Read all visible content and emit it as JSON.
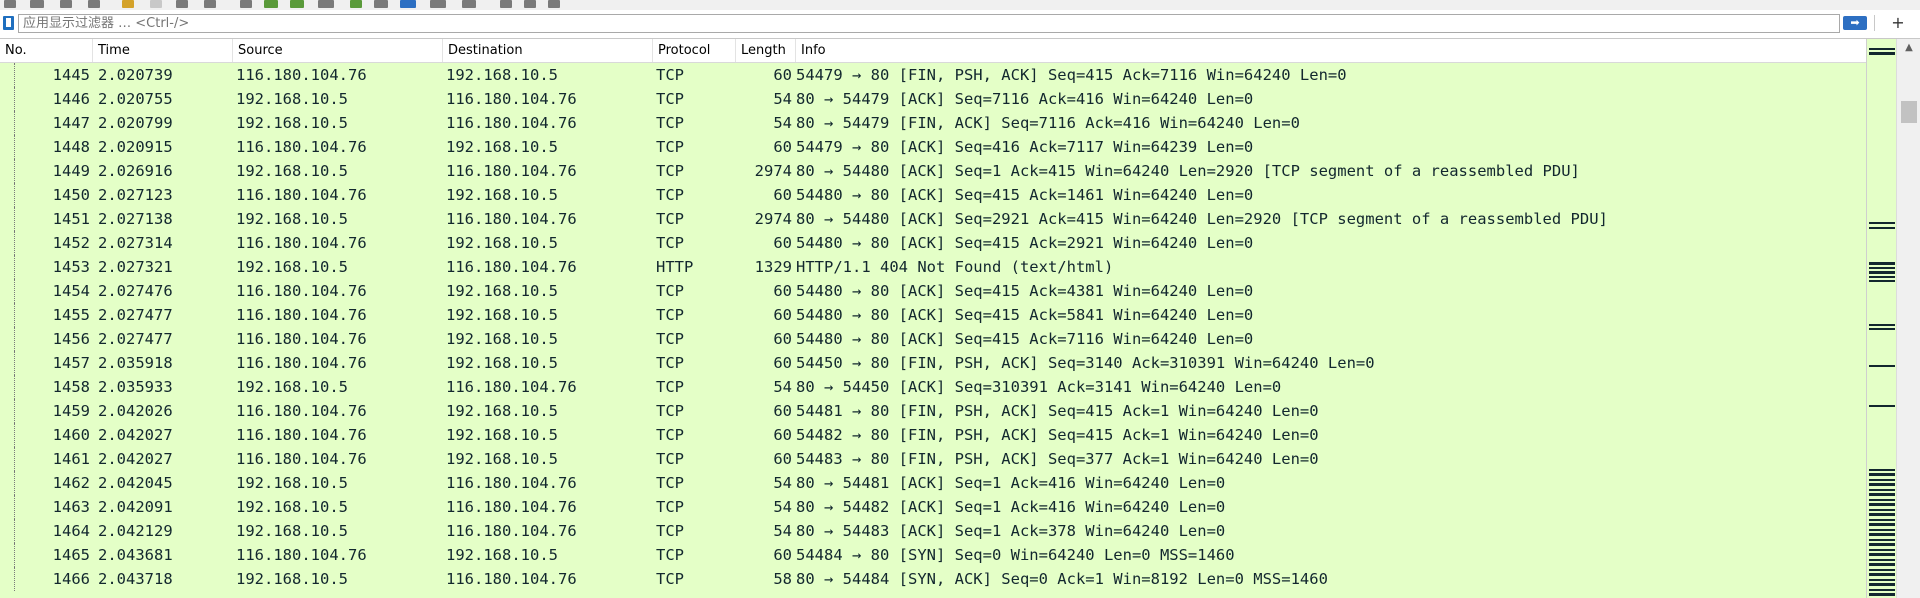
{
  "filter": {
    "label": "应用显示过滤器 …",
    "placeholder": "应用显示过滤器 … <Ctrl-/>"
  },
  "columns": [
    "No.",
    "Time",
    "Source",
    "Destination",
    "Protocol",
    "Length",
    "Info"
  ],
  "packets": [
    {
      "no": "1445",
      "time": "2.020739",
      "src": "116.180.104.76",
      "dst": "192.168.10.5",
      "proto": "TCP",
      "len": "60",
      "info": "54479 → 80 [FIN, PSH, ACK] Seq=415 Ack=7116 Win=64240 Len=0"
    },
    {
      "no": "1446",
      "time": "2.020755",
      "src": "192.168.10.5",
      "dst": "116.180.104.76",
      "proto": "TCP",
      "len": "54",
      "info": "80 → 54479 [ACK] Seq=7116 Ack=416 Win=64240 Len=0"
    },
    {
      "no": "1447",
      "time": "2.020799",
      "src": "192.168.10.5",
      "dst": "116.180.104.76",
      "proto": "TCP",
      "len": "54",
      "info": "80 → 54479 [FIN, ACK] Seq=7116 Ack=416 Win=64240 Len=0"
    },
    {
      "no": "1448",
      "time": "2.020915",
      "src": "116.180.104.76",
      "dst": "192.168.10.5",
      "proto": "TCP",
      "len": "60",
      "info": "54479 → 80 [ACK] Seq=416 Ack=7117 Win=64239 Len=0"
    },
    {
      "no": "1449",
      "time": "2.026916",
      "src": "192.168.10.5",
      "dst": "116.180.104.76",
      "proto": "TCP",
      "len": "2974",
      "info": "80 → 54480 [ACK] Seq=1 Ack=415 Win=64240 Len=2920 [TCP segment of a reassembled PDU]"
    },
    {
      "no": "1450",
      "time": "2.027123",
      "src": "116.180.104.76",
      "dst": "192.168.10.5",
      "proto": "TCP",
      "len": "60",
      "info": "54480 → 80 [ACK] Seq=415 Ack=1461 Win=64240 Len=0"
    },
    {
      "no": "1451",
      "time": "2.027138",
      "src": "192.168.10.5",
      "dst": "116.180.104.76",
      "proto": "TCP",
      "len": "2974",
      "info": "80 → 54480 [ACK] Seq=2921 Ack=415 Win=64240 Len=2920 [TCP segment of a reassembled PDU]"
    },
    {
      "no": "1452",
      "time": "2.027314",
      "src": "116.180.104.76",
      "dst": "192.168.10.5",
      "proto": "TCP",
      "len": "60",
      "info": "54480 → 80 [ACK] Seq=415 Ack=2921 Win=64240 Len=0"
    },
    {
      "no": "1453",
      "time": "2.027321",
      "src": "192.168.10.5",
      "dst": "116.180.104.76",
      "proto": "HTTP",
      "len": "1329",
      "info": "HTTP/1.1 404 Not Found  (text/html)"
    },
    {
      "no": "1454",
      "time": "2.027476",
      "src": "116.180.104.76",
      "dst": "192.168.10.5",
      "proto": "TCP",
      "len": "60",
      "info": "54480 → 80 [ACK] Seq=415 Ack=4381 Win=64240 Len=0"
    },
    {
      "no": "1455",
      "time": "2.027477",
      "src": "116.180.104.76",
      "dst": "192.168.10.5",
      "proto": "TCP",
      "len": "60",
      "info": "54480 → 80 [ACK] Seq=415 Ack=5841 Win=64240 Len=0"
    },
    {
      "no": "1456",
      "time": "2.027477",
      "src": "116.180.104.76",
      "dst": "192.168.10.5",
      "proto": "TCP",
      "len": "60",
      "info": "54480 → 80 [ACK] Seq=415 Ack=7116 Win=64240 Len=0"
    },
    {
      "no": "1457",
      "time": "2.035918",
      "src": "116.180.104.76",
      "dst": "192.168.10.5",
      "proto": "TCP",
      "len": "60",
      "info": "54450 → 80 [FIN, PSH, ACK] Seq=3140 Ack=310391 Win=64240 Len=0"
    },
    {
      "no": "1458",
      "time": "2.035933",
      "src": "192.168.10.5",
      "dst": "116.180.104.76",
      "proto": "TCP",
      "len": "54",
      "info": "80 → 54450 [ACK] Seq=310391 Ack=3141 Win=64240 Len=0"
    },
    {
      "no": "1459",
      "time": "2.042026",
      "src": "116.180.104.76",
      "dst": "192.168.10.5",
      "proto": "TCP",
      "len": "60",
      "info": "54481 → 80 [FIN, PSH, ACK] Seq=415 Ack=1 Win=64240 Len=0"
    },
    {
      "no": "1460",
      "time": "2.042027",
      "src": "116.180.104.76",
      "dst": "192.168.10.5",
      "proto": "TCP",
      "len": "60",
      "info": "54482 → 80 [FIN, PSH, ACK] Seq=415 Ack=1 Win=64240 Len=0"
    },
    {
      "no": "1461",
      "time": "2.042027",
      "src": "116.180.104.76",
      "dst": "192.168.10.5",
      "proto": "TCP",
      "len": "60",
      "info": "54483 → 80 [FIN, PSH, ACK] Seq=377 Ack=1 Win=64240 Len=0"
    },
    {
      "no": "1462",
      "time": "2.042045",
      "src": "192.168.10.5",
      "dst": "116.180.104.76",
      "proto": "TCP",
      "len": "54",
      "info": "80 → 54481 [ACK] Seq=1 Ack=416 Win=64240 Len=0"
    },
    {
      "no": "1463",
      "time": "2.042091",
      "src": "192.168.10.5",
      "dst": "116.180.104.76",
      "proto": "TCP",
      "len": "54",
      "info": "80 → 54482 [ACK] Seq=1 Ack=416 Win=64240 Len=0"
    },
    {
      "no": "1464",
      "time": "2.042129",
      "src": "192.168.10.5",
      "dst": "116.180.104.76",
      "proto": "TCP",
      "len": "54",
      "info": "80 → 54483 [ACK] Seq=1 Ack=378 Win=64240 Len=0"
    },
    {
      "no": "1465",
      "time": "2.043681",
      "src": "116.180.104.76",
      "dst": "192.168.10.5",
      "proto": "TCP",
      "len": "60",
      "info": "54484 → 80 [SYN] Seq=0 Win=64240 Len=0 MSS=1460"
    },
    {
      "no": "1466",
      "time": "2.043718",
      "src": "192.168.10.5",
      "dst": "116.180.104.76",
      "proto": "TCP",
      "len": "58",
      "info": "80 → 54484 [SYN, ACK] Seq=0 Ack=1 Win=8192 Len=0 MSS=1460"
    }
  ],
  "colors": {
    "tcp_row_bg": "#e4ffc7",
    "row_text": "#12272e",
    "accent": "#2d6fc2"
  },
  "icons": [
    "bookmark-icon",
    "apply-filter-arrow-icon",
    "add-filter-button-icon",
    "scroll-up-arrow-icon"
  ]
}
